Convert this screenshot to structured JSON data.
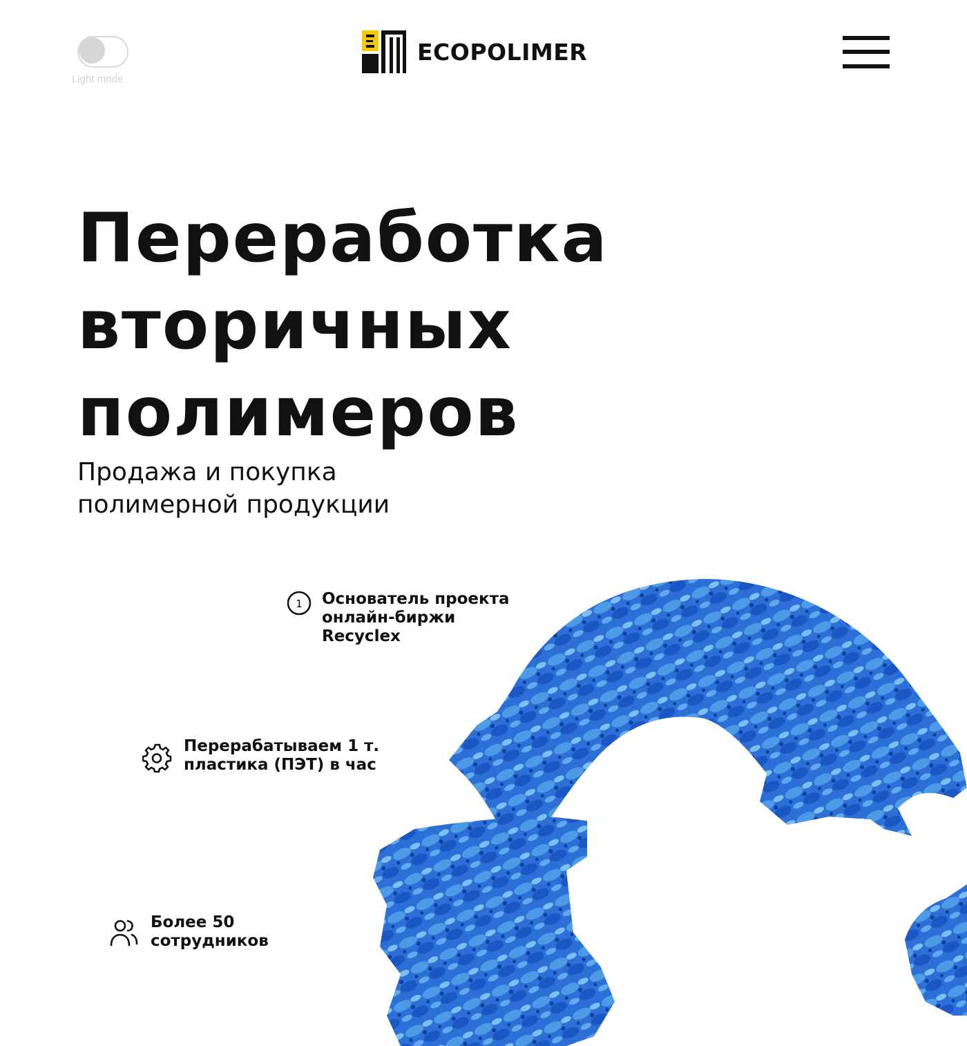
{
  "header": {
    "theme_toggle_label": "Light mode",
    "brand_name": "ECOPOLIMER"
  },
  "hero": {
    "title_lines": [
      "Переработка",
      "вторичных",
      "полимеров"
    ],
    "subtitle_lines": [
      "Продажа и покупка",
      "полимерной продукции"
    ]
  },
  "features": [
    {
      "icon": "number-one-circle-icon",
      "lines": [
        "Основатель проекта",
        "онлайн-биржи",
        "Recyclex"
      ]
    },
    {
      "icon": "gear-icon",
      "lines": [
        "Перерабатываем 1 т.",
        "пластика (ПЭТ) в час"
      ]
    },
    {
      "icon": "users-icon",
      "lines": [
        "Более 50",
        "сотрудников"
      ]
    }
  ],
  "feature_badge_number": "1",
  "colors": {
    "brand_yellow": "#f2cb05",
    "text": "#111111",
    "bottle_blue_dark": "#1a56c4",
    "bottle_blue_light": "#4d9be6"
  }
}
